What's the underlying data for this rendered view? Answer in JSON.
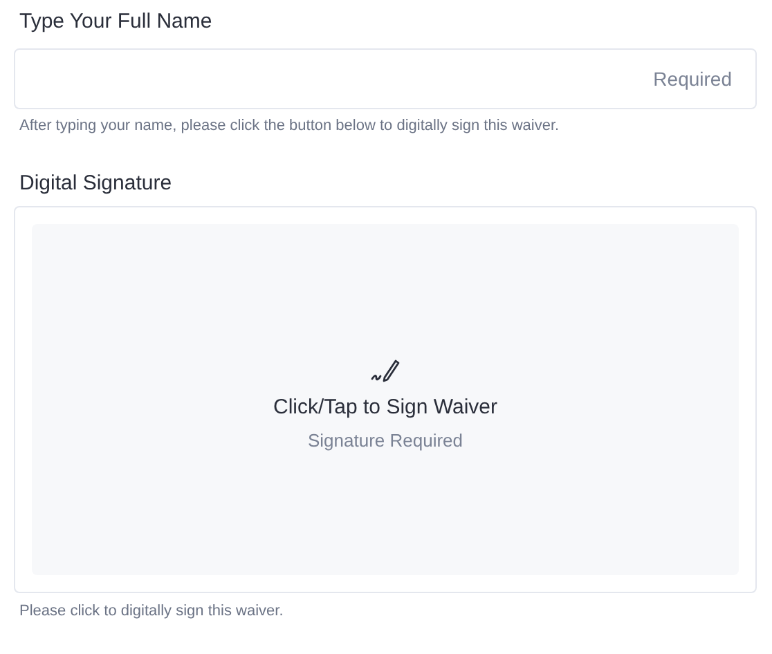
{
  "name_field": {
    "label": "Type Your Full Name",
    "placeholder": "Required",
    "hint": "After typing your name, please click the button below to digitally sign this waiver."
  },
  "signature": {
    "label": "Digital Signature",
    "action": "Click/Tap to Sign Waiver",
    "status": "Signature Required",
    "hint": "Please click to digitally sign this waiver."
  }
}
